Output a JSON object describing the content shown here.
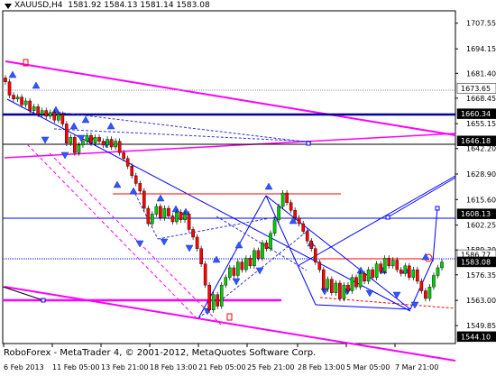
{
  "chart_data": {
    "type": "candlestick",
    "symbol_header": "XAUUSD,H4  1581.92 1584.13 1581.14 1583.08",
    "footer": "RoboForex - MetaTrader 4, © 2001-2012, MetaQuotes Software Corp.",
    "price_axis_ticks": [
      1707.55,
      1694.15,
      1681.4,
      1668.45,
      1655.15,
      1642.2,
      1628.9,
      1615.6,
      1602.25,
      1589.3,
      1576.35,
      1563.0,
      1549.85
    ],
    "price_labels": [
      {
        "value": 1673.65,
        "text": "1673.65",
        "style": "light"
      },
      {
        "value": 1660.34,
        "text": "1660.34",
        "style": "dark"
      },
      {
        "value": 1646.18,
        "text": "1646.18",
        "style": "dark"
      },
      {
        "value": 1608.13,
        "text": "1608.13",
        "style": "dark"
      },
      {
        "value": 1586.77,
        "text": "1586.77",
        "style": "light"
      },
      {
        "value": 1583.08,
        "text": "1583.08",
        "style": "dark"
      },
      {
        "value": 1544.1,
        "text": "1544.10",
        "style": "dark"
      }
    ],
    "time_ticks": [
      "6 Feb 2013",
      "11 Feb 05:00",
      "13 Feb 21:00",
      "18 Feb 13:00",
      "21 Feb 05:00",
      "25 Feb 21:00",
      "28 Feb 13:00",
      "5 Mar 05:00",
      "7 Mar 21:00"
    ],
    "closes": [
      1677,
      1670,
      1668,
      1669,
      1665,
      1667,
      1662,
      1664,
      1660,
      1662,
      1659,
      1661,
      1657,
      1660,
      1655,
      1645,
      1648,
      1640,
      1644,
      1646,
      1649,
      1645,
      1648,
      1646,
      1644,
      1647,
      1643,
      1646,
      1640,
      1637,
      1633,
      1628,
      1624,
      1620,
      1611,
      1603,
      1608,
      1612,
      1606,
      1611,
      1607,
      1604,
      1609,
      1605,
      1608,
      1600,
      1596,
      1590,
      1582,
      1571,
      1558,
      1566,
      1560,
      1571,
      1575,
      1580,
      1576,
      1583,
      1579,
      1585,
      1581,
      1589,
      1585,
      1593,
      1590,
      1598,
      1605,
      1612,
      1619,
      1614,
      1610,
      1606,
      1603,
      1599,
      1594,
      1590,
      1583,
      1579,
      1569,
      1574,
      1567,
      1572,
      1564,
      1571,
      1568,
      1575,
      1570,
      1577,
      1573,
      1579,
      1575,
      1582,
      1578,
      1585,
      1581,
      1584,
      1579,
      1577,
      1581,
      1575,
      1579,
      1573,
      1568,
      1564,
      1570,
      1576,
      1580,
      1583
    ],
    "colors": {
      "background": "#ffffff",
      "magenta": "#ff00ff",
      "navy": "#000099",
      "blue": "#0000ff",
      "dashed_blue": "#3333cc",
      "red": "#ff0000",
      "candle_up": "#00cc00",
      "candle_down": "#ff0000",
      "arrow": "#3355ff"
    }
  }
}
